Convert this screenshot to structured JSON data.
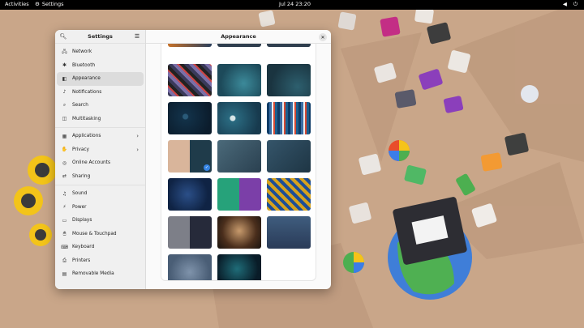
{
  "topbar": {
    "activities": "Activities",
    "app_name": "Settings",
    "clock": "Jul 24  23:20"
  },
  "sidebar": {
    "title": "Settings",
    "items": [
      {
        "label": "Network",
        "icon": "network-icon"
      },
      {
        "label": "Bluetooth",
        "icon": "bluetooth-icon"
      },
      {
        "label": "Appearance",
        "icon": "appearance-icon",
        "active": true
      },
      {
        "label": "Notifications",
        "icon": "bell-icon"
      },
      {
        "label": "Search",
        "icon": "search-icon"
      },
      {
        "label": "Multitasking",
        "icon": "multitasking-icon"
      },
      {
        "label": "Applications",
        "icon": "applications-icon",
        "chevron": true
      },
      {
        "label": "Privacy",
        "icon": "privacy-icon",
        "chevron": true
      },
      {
        "label": "Online Accounts",
        "icon": "online-accounts-icon"
      },
      {
        "label": "Sharing",
        "icon": "sharing-icon"
      },
      {
        "label": "Sound",
        "icon": "sound-icon"
      },
      {
        "label": "Power",
        "icon": "power-icon"
      },
      {
        "label": "Displays",
        "icon": "displays-icon"
      },
      {
        "label": "Mouse & Touchpad",
        "icon": "mouse-icon"
      },
      {
        "label": "Keyboard",
        "icon": "keyboard-icon"
      },
      {
        "label": "Printers",
        "icon": "printer-icon"
      },
      {
        "label": "Removable Media",
        "icon": "removable-media-icon"
      }
    ]
  },
  "content": {
    "title": "Appearance"
  },
  "wallpapers": [
    {
      "name": "pixel-mosaic"
    },
    {
      "name": "teal-swirl"
    },
    {
      "name": "dark-teal"
    },
    {
      "name": "deep-blue-moon"
    },
    {
      "name": "teal-moon"
    },
    {
      "name": "color-stripes"
    },
    {
      "name": "dots-split",
      "selected": true
    },
    {
      "name": "grey-waves"
    },
    {
      "name": "slate-waves"
    },
    {
      "name": "blue-swirl"
    },
    {
      "name": "green-purple-split"
    },
    {
      "name": "gold-blue-pattern"
    },
    {
      "name": "grey-split"
    },
    {
      "name": "bronze-glow"
    },
    {
      "name": "slate-blue"
    },
    {
      "name": "grey-blue-swirl"
    },
    {
      "name": "dark-teal-glow"
    }
  ],
  "colors": {
    "accent": "#3584e4",
    "wallpaper": "#c9a689"
  }
}
